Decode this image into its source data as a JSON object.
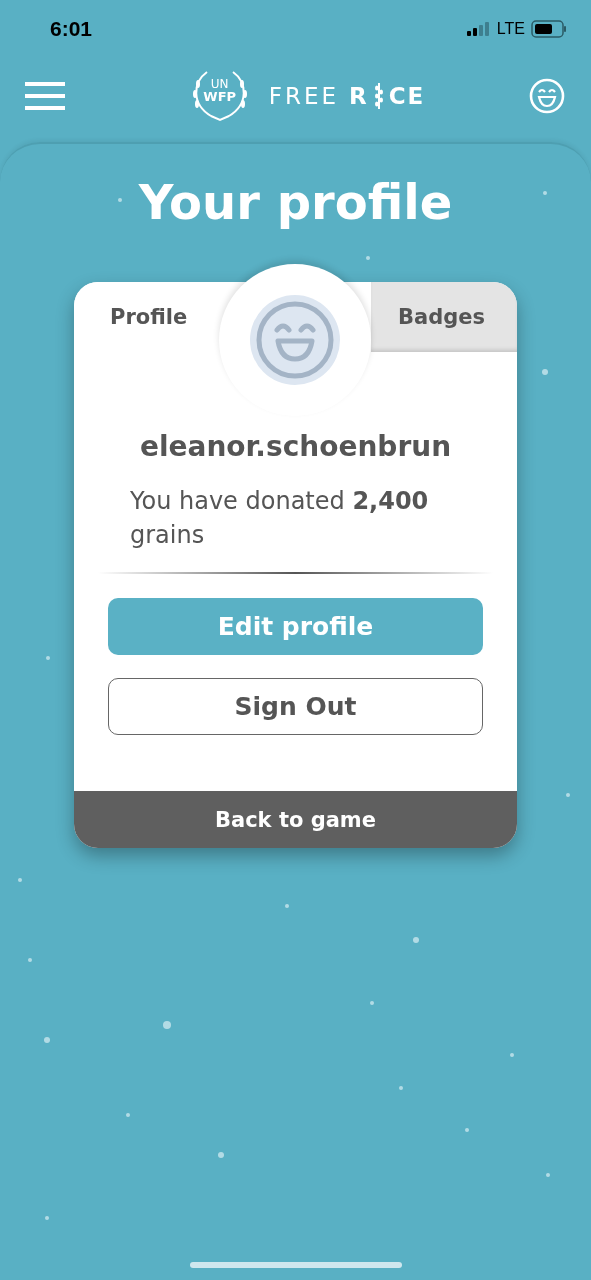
{
  "status_bar": {
    "time": "6:01",
    "network": "LTE"
  },
  "header": {
    "logo": {
      "un": "UN",
      "wfp": "WFP",
      "word_1": "FREE",
      "word_2_start": "R",
      "word_2_end": "CE"
    }
  },
  "title": "Your profile",
  "tabs": [
    {
      "label": "Profile",
      "selected": true
    },
    {
      "label": "Badges",
      "selected": false
    }
  ],
  "profile": {
    "username": "eleanor.schoenbrun",
    "donation_text": "You have donated **2,400** grains"
  },
  "buttons": [
    {
      "label": "Edit profile",
      "kind": "primary"
    },
    {
      "label": "Sign Out",
      "kind": "outline"
    }
  ],
  "footer_button": "Back to game"
}
